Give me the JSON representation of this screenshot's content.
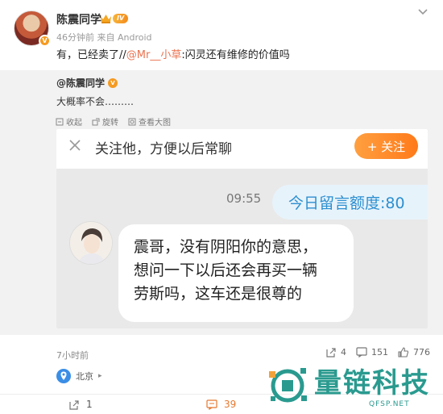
{
  "post": {
    "username": "陈震同学",
    "vip_level": "IV",
    "meta": "46分钟前  来自 Android",
    "text_prefix": "有，已经卖了//",
    "mention": "@Mr__小草",
    "text_suffix": ":闪灵还有维修的价值吗"
  },
  "repost": {
    "original_user": "@陈震同学",
    "original_text": "大概率不会………",
    "actions": [
      {
        "label": "收起",
        "icon": "collapse-icon"
      },
      {
        "label": "旋转",
        "icon": "rotate-icon"
      },
      {
        "label": "查看大图",
        "icon": "view-large-icon"
      }
    ]
  },
  "screenshot": {
    "follow_prompt": "关注他，方便以后常聊",
    "follow_button": "+ 关注",
    "chat_time": "09:55",
    "quota": "今日留言额度:80",
    "message_lines": [
      "震哥，没有阴阳你的意思，",
      "想问一下以后还会再买一辆",
      "劳斯吗，这车还是很尊的"
    ]
  },
  "footer": {
    "time_ago": "7小时前",
    "reposts": "4",
    "comments": "151",
    "likes": "776",
    "location": "北京",
    "bottom_reposts": "1",
    "bottom_comments": "39"
  },
  "watermark": {
    "title": "量链科技",
    "domain": "QFSP.NET"
  },
  "colors": {
    "accent_orange": "#ff8a22",
    "mention": "#eb7350",
    "quota_blue": "#2d8fd0",
    "watermark_teal": "#2a9a8f"
  }
}
